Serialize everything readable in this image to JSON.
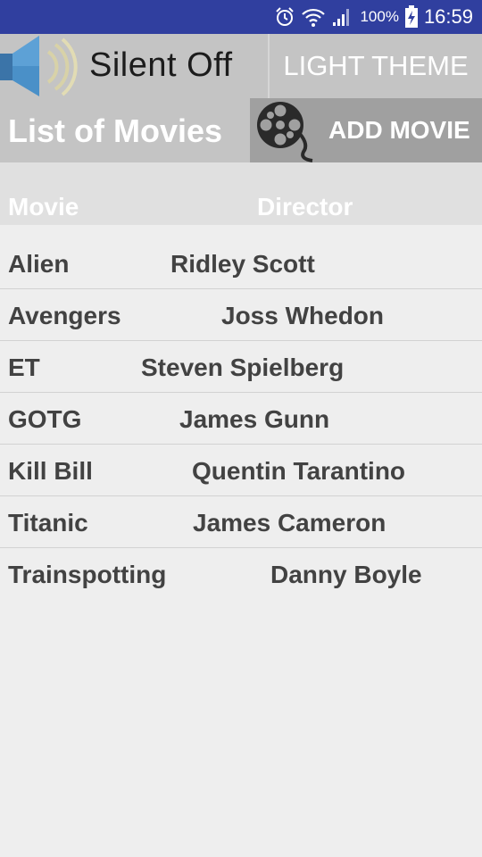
{
  "status_bar": {
    "battery": "100%",
    "time": "16:59",
    "icons": [
      "alarm-icon",
      "wifi-icon",
      "signal-icon",
      "battery-charging-icon"
    ]
  },
  "toolbar": {
    "silent_label": "Silent Off",
    "speaker_icon": "speaker-icon",
    "theme_label": "LIGHT THEME"
  },
  "title_bar": {
    "title": "List of Movies",
    "add_label": "ADD MOVIE",
    "reel_icon": "film-reel-icon"
  },
  "table": {
    "headers": {
      "movie": "Movie",
      "director": "Director"
    },
    "rows": [
      {
        "movie": "Alien",
        "director": "Ridley Scott"
      },
      {
        "movie": "Avengers",
        "director": "Joss Whedon"
      },
      {
        "movie": "ET",
        "director": "Steven Spielberg"
      },
      {
        "movie": "GOTG",
        "director": "James Gunn"
      },
      {
        "movie": "Kill Bill",
        "director": "Quentin Tarantino"
      },
      {
        "movie": "Titanic",
        "director": "James Cameron"
      },
      {
        "movie": "Trainspotting",
        "director": "Danny Boyle"
      }
    ]
  },
  "colors": {
    "status_bar": "#303f9f",
    "toolbar": "#c4c4c4",
    "add_button": "#a0a0a0",
    "header_row": "#e0e0e0",
    "background": "#eeeeee",
    "row_text": "#424242"
  }
}
